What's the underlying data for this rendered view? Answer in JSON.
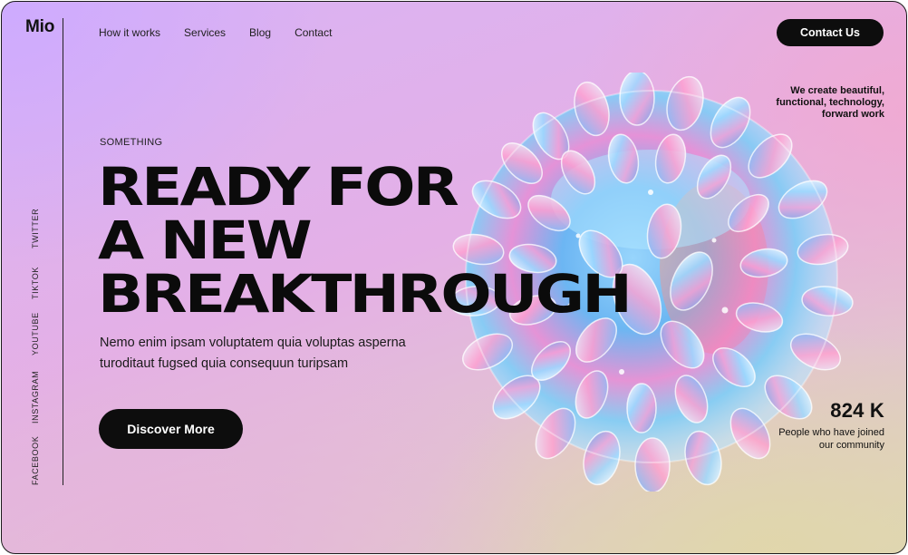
{
  "brand": {
    "logo": "Mio"
  },
  "nav": {
    "items": [
      "How it works",
      "Services",
      "Blog",
      "Contact"
    ],
    "contact_button": "Contact Us"
  },
  "tagline": "We create beautiful, functional, technology, forward work",
  "social": [
    "TWITTER",
    "TIKTOK",
    "YOUTUBE",
    "INSTAGRAM",
    "FACEBOOK"
  ],
  "hero": {
    "eyebrow": "SOMETHING",
    "headline": [
      "READY FOR",
      "A NEW",
      "BREAKTHROUGH"
    ],
    "body": "Nemo enim ipsam voluptatem quia voluptas asperna turoditaut fugsed quia consequun turipsam",
    "cta": "Discover More",
    "image": "iridescent-glass-sphere"
  },
  "stat": {
    "value": "824 K",
    "label": "People who have joined our community"
  },
  "colors": {
    "accent_dark": "#0d0d0d",
    "gradient_purple": "#d9b3f5",
    "gradient_pink": "#f0aad2",
    "gradient_cream": "#dcd6b8"
  }
}
